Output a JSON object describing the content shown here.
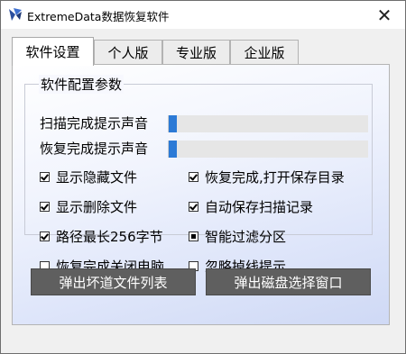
{
  "window": {
    "title": "ExtremeData数据恢复软件",
    "close_symbol": "✕"
  },
  "tabs": [
    {
      "label": "软件设置",
      "active": true
    },
    {
      "label": "个人版",
      "active": false
    },
    {
      "label": "专业版",
      "active": false
    },
    {
      "label": "企业版",
      "active": false
    }
  ],
  "group": {
    "title": "软件配置参数"
  },
  "sliders": [
    {
      "label": "扫描完成提示声音",
      "value": 0.04
    },
    {
      "label": "恢复完成提示声音",
      "value": 0.04
    }
  ],
  "options": [
    {
      "label": "显示隐藏文件",
      "state": "checked"
    },
    {
      "label": "恢复完成,打开保存目录",
      "state": "checked"
    },
    {
      "label": "显示删除文件",
      "state": "checked"
    },
    {
      "label": "自动保存扫描记录",
      "state": "checked"
    },
    {
      "label": "路径最长256字节",
      "state": "checked"
    },
    {
      "label": "智能过滤分区",
      "state": "indeterminate"
    },
    {
      "label": "恢复完成关闭电脑",
      "state": "unchecked"
    },
    {
      "label": "忽略掉线提示",
      "state": "unchecked"
    }
  ],
  "buttons": {
    "bad_sectors": "弹出坏道文件列表",
    "disk_select": "弹出磁盘选择窗口"
  },
  "colors": {
    "slider_fill": "#2c7ad6",
    "button_bg": "#5f5f5f"
  }
}
